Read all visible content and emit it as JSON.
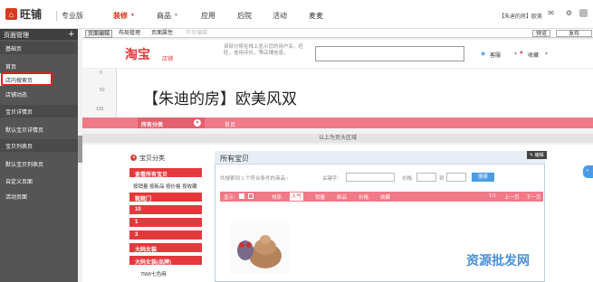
{
  "topbar": {
    "logo": "旺铺",
    "edition": "专业版",
    "nav": [
      "装修",
      "商品",
      "应用",
      "后院",
      "活动",
      "麦麦"
    ],
    "user": "【朱迪的房】欧美",
    "icons": [
      "mail-icon",
      "gear-icon",
      "avatar-icon"
    ]
  },
  "sidebar": {
    "title": "页面管理",
    "add": "+",
    "items": [
      {
        "label": "基础页",
        "group": true
      },
      {
        "label": "首页"
      },
      {
        "label": "店内搜索页",
        "selected": true
      },
      {
        "label": "店铺动态"
      },
      {
        "label": "宝贝详情页",
        "group": true
      },
      {
        "label": "默认宝贝详情页"
      },
      {
        "label": "宝贝列表页",
        "group": true
      },
      {
        "label": "默认宝贝列表页"
      },
      {
        "label": "自定义页",
        "group": true
      },
      {
        "label": "自定义页面"
      },
      {
        "label": "活动页面"
      }
    ]
  },
  "toolbar": {
    "tabs": [
      "页面编辑",
      "布局管理",
      "页面属性"
    ],
    "disabled": "不可编辑",
    "preview": "预览",
    "publish": "发布"
  },
  "header": {
    "brand": "淘宝",
    "brand_sub": "店铺",
    "hint": "该部分将在线上显示您的用户名，旺旺，信用评价，等店铺信息。",
    "service": "客服",
    "fav": "收藏"
  },
  "ruler": [
    "0",
    "50",
    "100"
  ],
  "banner": {
    "shop_name": "【朱迪的房】欧美风双"
  },
  "navbar": {
    "category": "所有分类",
    "home": "首页"
  },
  "separator": "以上为页头区域",
  "left": {
    "title": "宝贝分类",
    "view_all": "查看所有宝贝",
    "sorts": "按销量 按新品 按价格 按收藏",
    "cats": [
      "靴靴门",
      "10",
      "1",
      "3",
      "大码女装",
      "大码女装(品牌)"
    ],
    "sub": "75M/七色麻"
  },
  "right": {
    "title": "所有宝贝",
    "edit": "编辑",
    "found": "共搜索到 1 个符合条件的商品~",
    "kw_label": "关键字:",
    "price_label": "价格:",
    "to": "到",
    "search_btn": "搜索",
    "view_label": "显示:",
    "sort_label": "排序:",
    "sorts": [
      "人气",
      "销量",
      "新品",
      "价格",
      "收藏"
    ],
    "page": "1/1",
    "prev": "上一页",
    "next": "下一页"
  },
  "watermark": "资源批发网"
}
